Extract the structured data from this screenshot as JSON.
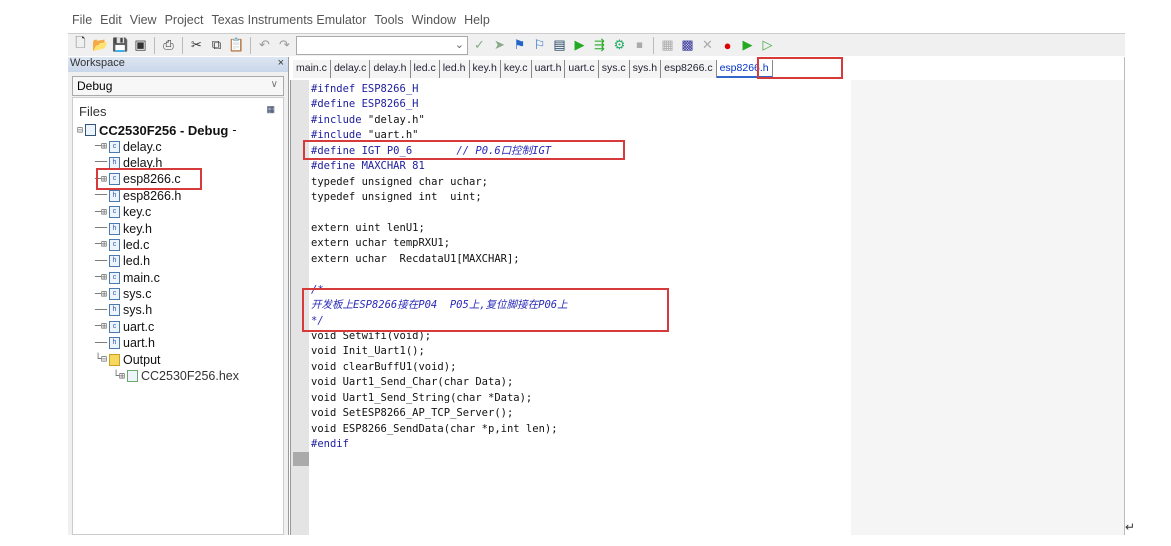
{
  "menu": [
    "File",
    "Edit",
    "View",
    "Project",
    "Texas Instruments Emulator",
    "Tools",
    "Window",
    "Help"
  ],
  "toolbar": {
    "icons": [
      "new-file",
      "open",
      "save",
      "save-all",
      "print",
      "cut",
      "copy",
      "paste",
      "undo",
      "redo"
    ],
    "combo_value": "",
    "icons_right": [
      "toggle-bookmark",
      "next-bookmark",
      "find",
      "replace",
      "go-to",
      "compile",
      "make",
      "debug",
      "stop-build",
      "breakpoint",
      "watch",
      "disable",
      "toggle-breakpoint",
      "download-debug",
      "debug-without-download"
    ]
  },
  "workspace": {
    "title": "Workspace",
    "close": "×",
    "config": "Debug",
    "files_label": "Files",
    "project": "CC2530F256 - Debug",
    "items": [
      {
        "name": "delay.c",
        "type": "c",
        "expand": "⊞"
      },
      {
        "name": "delay.h",
        "type": "h",
        "expand": ""
      },
      {
        "name": "esp8266.c",
        "type": "c",
        "expand": "⊞"
      },
      {
        "name": "esp8266.h",
        "type": "h",
        "expand": ""
      },
      {
        "name": "key.c",
        "type": "c",
        "expand": "⊞"
      },
      {
        "name": "key.h",
        "type": "h",
        "expand": ""
      },
      {
        "name": "led.c",
        "type": "c",
        "expand": "⊞"
      },
      {
        "name": "led.h",
        "type": "h",
        "expand": ""
      },
      {
        "name": "main.c",
        "type": "c",
        "expand": "⊞"
      },
      {
        "name": "sys.c",
        "type": "c",
        "expand": "⊞"
      },
      {
        "name": "sys.h",
        "type": "h",
        "expand": ""
      },
      {
        "name": "uart.c",
        "type": "c",
        "expand": "⊞"
      },
      {
        "name": "uart.h",
        "type": "h",
        "expand": ""
      }
    ],
    "output_folder": "Output",
    "output_file": "CC2530F256.hex"
  },
  "tabs": [
    "main.c",
    "delay.c",
    "delay.h",
    "led.c",
    "led.h",
    "key.h",
    "key.c",
    "uart.h",
    "uart.c",
    "sys.c",
    "sys.h",
    "esp8266.c",
    "esp8266.h"
  ],
  "active_tab": "esp8266.h",
  "code": [
    [
      [
        "pp",
        "#ifndef ESP8266_H"
      ]
    ],
    [
      [
        "pp",
        "#define ESP8266_H"
      ]
    ],
    [
      [
        "pp",
        "#include "
      ],
      [
        "kw",
        "\"delay.h\""
      ]
    ],
    [
      [
        "pp",
        "#include "
      ],
      [
        "kw",
        "\"uart.h\""
      ]
    ],
    [
      [
        "pp",
        "#define IGT P0_6"
      ],
      [
        "cm",
        "       // P0.6口控制IGT"
      ]
    ],
    [
      [
        "pp",
        "#define MAXCHAR 81"
      ]
    ],
    [
      [
        "kw",
        "typedef unsigned char uchar;"
      ]
    ],
    [
      [
        "kw",
        "typedef unsigned int  uint;"
      ]
    ],
    [
      [
        "kw",
        ""
      ]
    ],
    [
      [
        "kw",
        "extern uint lenU1;"
      ]
    ],
    [
      [
        "kw",
        "extern uchar tempRXU1;"
      ]
    ],
    [
      [
        "kw",
        "extern uchar  RecdataU1[MAXCHAR];"
      ]
    ],
    [
      [
        "kw",
        ""
      ]
    ],
    [
      [
        "cm",
        "/*"
      ]
    ],
    [
      [
        "cm",
        "开发板上ESP8266接在P04  P05上,复位脚接在P06上"
      ]
    ],
    [
      [
        "cm",
        "*/"
      ]
    ],
    [
      [
        "kw",
        "void Setwifi(void);"
      ]
    ],
    [
      [
        "kw",
        "void Init_Uart1();"
      ]
    ],
    [
      [
        "kw",
        "void clearBuffU1(void);"
      ]
    ],
    [
      [
        "kw",
        "void Uart1_Send_Char(char Data);"
      ]
    ],
    [
      [
        "kw",
        "void Uart1_Send_String(char *Data);"
      ]
    ],
    [
      [
        "kw",
        "void SetESP8266_AP_TCP_Server();"
      ]
    ],
    [
      [
        "kw",
        "void ESP8266_SendData(char *p,int len);"
      ]
    ],
    [
      [
        "pp",
        "#endif"
      ]
    ]
  ],
  "colors": {
    "highlight_box": "#d63a3a",
    "preprocessor": "#2020a0",
    "comment": "#2a2ab8"
  }
}
